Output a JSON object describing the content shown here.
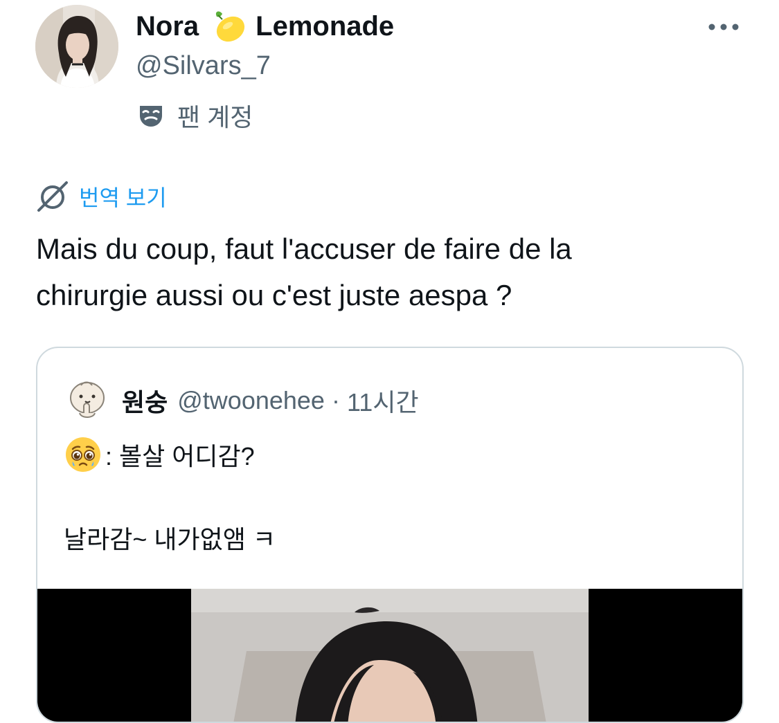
{
  "tweet": {
    "author": {
      "name_first": "Nora",
      "name_emoji": "lemon-emoji",
      "name_last": "Lemonade",
      "handle": "@Silvars_7",
      "label_icon": "theater-masks-icon",
      "label": "팬 계정"
    },
    "more_icon": "more-options-icon",
    "translate": {
      "icon": "translate-icon",
      "label": "번역 보기"
    },
    "text_lines": [
      "Mais du coup, faut l'accuser de  faire de la",
      "chirurgie aussi ou c'est juste aespa ?"
    ]
  },
  "quote": {
    "author_name": "원숭",
    "author_handle": "@twoonehee",
    "separator": "·",
    "time": "11시간",
    "line1_emoji": "pleading-face-emoji",
    "line1_text": ": 볼살 어디감?",
    "line2_text": "날라감~ 내가없앰 ㅋ"
  },
  "colors": {
    "text_primary": "#0f1419",
    "text_secondary": "#536471",
    "link": "#1d9bf0",
    "border": "#cfd9de"
  }
}
